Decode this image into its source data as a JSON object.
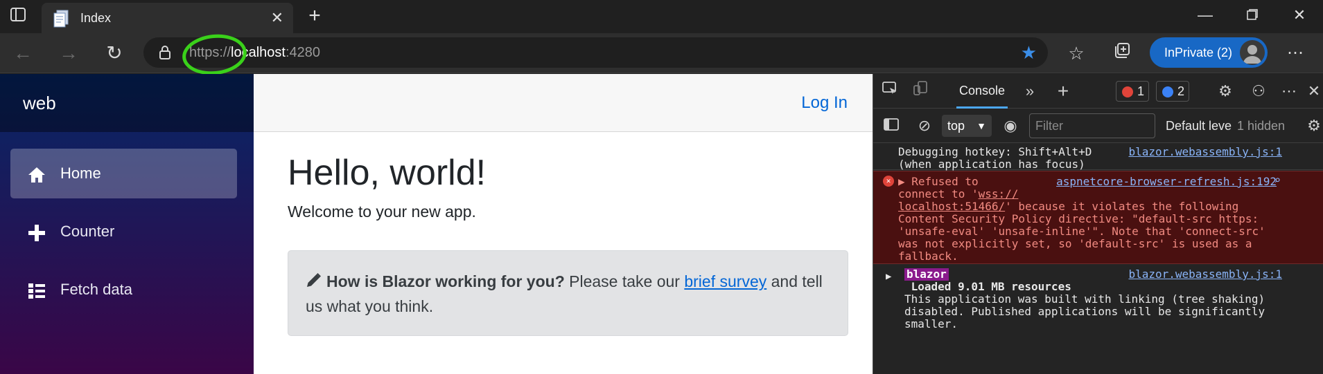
{
  "browser": {
    "tab_title": "Index",
    "url_scheme": "https://",
    "url_host": "localhost",
    "url_port": ":4280",
    "inprivate_label": "InPrivate (2)",
    "accent_color": "#1868c5",
    "annotation_color": "#3ad11a"
  },
  "sidebar": {
    "brand": "web",
    "items": [
      {
        "label": "Home",
        "icon": "home-icon",
        "active": true
      },
      {
        "label": "Counter",
        "icon": "plus-icon",
        "active": false
      },
      {
        "label": "Fetch data",
        "icon": "list-icon",
        "active": false
      }
    ]
  },
  "main": {
    "login_link": "Log In",
    "heading": "Hello, world!",
    "welcome": "Welcome to your new app.",
    "survey": {
      "question": "How is Blazor working for you?",
      "text_before_link": " Please take our ",
      "link": "brief survey",
      "text_after_link": " and tell us what you think."
    }
  },
  "devtools": {
    "active_tab": "Console",
    "error_count": "1",
    "info_count": "2",
    "context": "top",
    "filter_placeholder": "Filter",
    "level": "Default leve",
    "hidden": "1 hidden",
    "messages": [
      {
        "lines": [
          "Debugging hotkey: Shift+Alt+D",
          "(when application has focus)"
        ],
        "source": "blazor.webassembly.js:1"
      },
      {
        "type": "error",
        "first": "Refused to",
        "source": "aspnetcore-browser-refresh.js:192",
        "line2_before": "connect to '",
        "line2_link": "wss://",
        "line3_link": "localhost:51466/",
        "line3_after": "' because it violates the following",
        "lines": [
          "Content Security Policy directive: \"default-src https:",
          "'unsafe-eval' 'unsafe-inline'\". Note that 'connect-src'",
          "was not explicitly set, so 'default-src' is used as a",
          "fallback."
        ]
      },
      {
        "badge": "blazor",
        "source": "blazor.webassembly.js:1",
        "bold": "Loaded 9.01 MB resources",
        "lines": [
          "This application was built with linking (tree shaking)",
          "disabled. Published applications will be significantly",
          "smaller."
        ]
      }
    ]
  }
}
